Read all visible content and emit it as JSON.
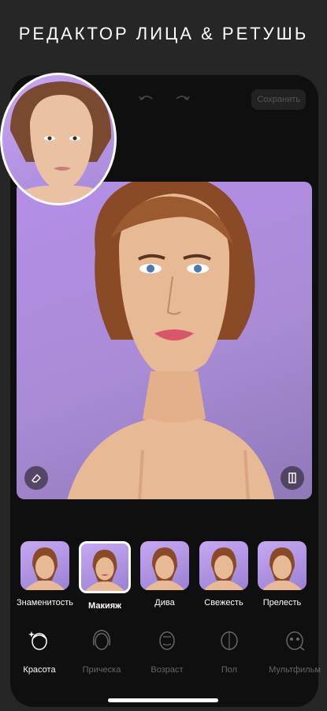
{
  "headline": "РЕДАКТОР ЛИЦА & РЕТУШЬ",
  "toolbar": {
    "save_label": "Сохранить"
  },
  "filters": [
    {
      "label": "Знаменитость",
      "active": false
    },
    {
      "label": "Макияж",
      "active": true
    },
    {
      "label": "Дива",
      "active": false
    },
    {
      "label": "Свежесть",
      "active": false
    },
    {
      "label": "Прелесть",
      "active": false
    }
  ],
  "tabs": [
    {
      "label": "Красота",
      "icon": "beauty-face-icon",
      "active": true
    },
    {
      "label": "Прическа",
      "icon": "hairstyle-icon",
      "active": false
    },
    {
      "label": "Возраст",
      "icon": "age-face-icon",
      "active": false
    },
    {
      "label": "Пол",
      "icon": "gender-face-icon",
      "active": false
    },
    {
      "label": "Мультфильм",
      "icon": "cartoon-face-icon",
      "active": false
    }
  ],
  "colors": {
    "canvas_bg": "#b58ee8",
    "app_bg": "#0f0f0f"
  }
}
